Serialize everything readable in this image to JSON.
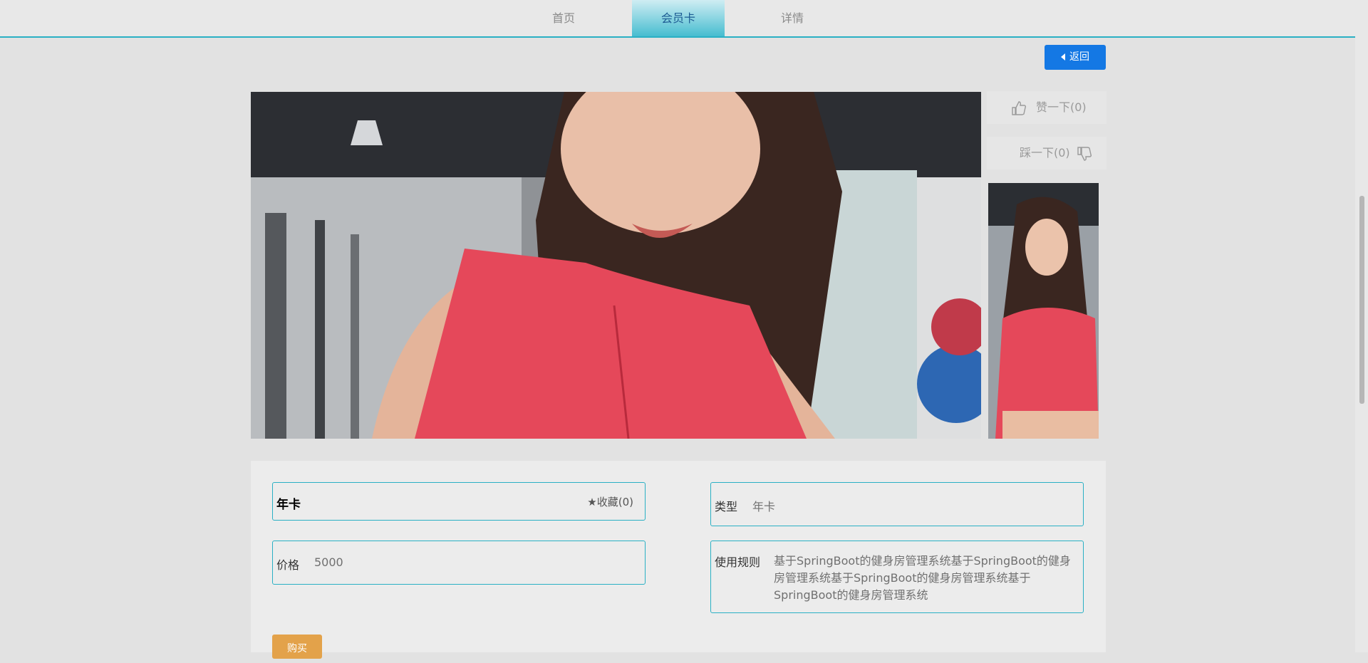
{
  "nav": {
    "items": [
      {
        "label": "首页"
      },
      {
        "label": "会员卡"
      },
      {
        "label": "详情"
      }
    ]
  },
  "back_button": {
    "label": "返回"
  },
  "vote": {
    "like_label": "赞一下(0)",
    "dislike_label": "踩一下(0)"
  },
  "card": {
    "name": "年卡",
    "favorite_label": "收藏(0)",
    "price_label": "价格",
    "price_value": "5000",
    "type_label": "类型",
    "type_value": "年卡",
    "rules_label": "使用规则",
    "rules_value": "基于SpringBoot的健身房管理系统基于SpringBoot的健身房管理系统基于SpringBoot的健身房管理系统基于SpringBoot的健身房管理系统"
  },
  "buy_button": {
    "label": "购买"
  },
  "colors": {
    "accent": "#2ab0c4",
    "back_button": "#1478e4",
    "buy_button": "#e3a24a"
  }
}
